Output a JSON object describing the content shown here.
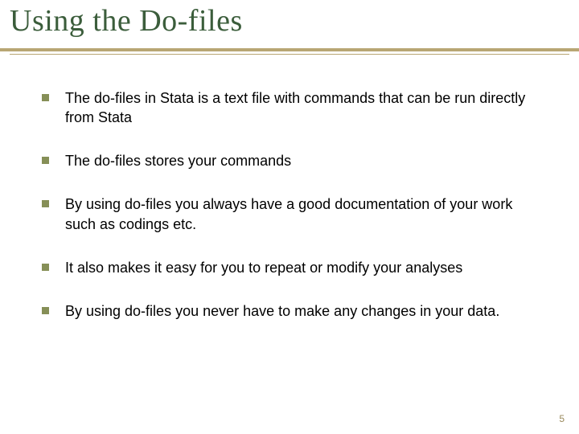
{
  "title": "Using the Do-files",
  "bullets": [
    "The do-files in Stata is a text file with commands that can be run directly from Stata",
    "The do-files stores your commands",
    "By using do-files you always have a good documentation of your work such as codings etc.",
    "It also makes it easy for you to repeat or modify your analyses",
    "By using do-files you never have to make any changes in your data."
  ],
  "page_number": "5"
}
